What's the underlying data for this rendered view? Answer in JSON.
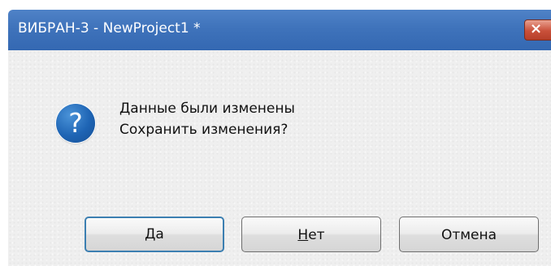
{
  "window": {
    "title": "ВИБРАН-3 - NewProject1 *",
    "close_label": "×"
  },
  "message": {
    "icon": "question-icon",
    "line1": "Данные были изменены",
    "line2": "Сохранить изменения?"
  },
  "buttons": {
    "yes": {
      "mnemonic": "Д",
      "rest": "а"
    },
    "no": {
      "mnemonic": "Н",
      "rest": "ет"
    },
    "cancel": {
      "label": "Отмена"
    }
  },
  "colors": {
    "titlebar": "#3f73bb",
    "close_button": "#c9503a",
    "icon": "#1e64b4",
    "client_bg": "#efefef",
    "focus_border": "#3c7fb1"
  }
}
